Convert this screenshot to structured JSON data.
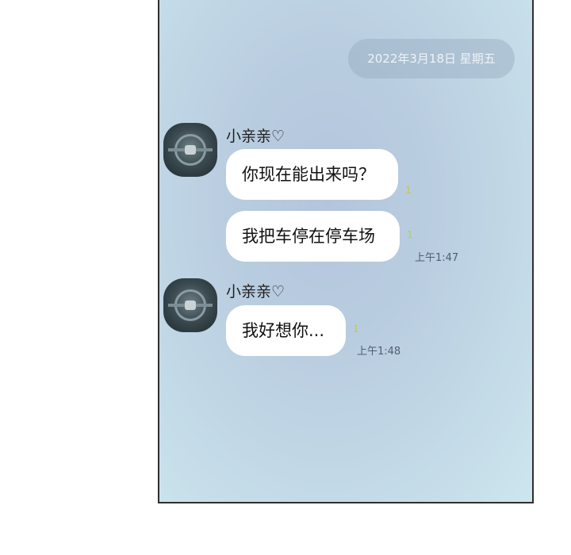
{
  "chat": {
    "date": "2022年3月18日 星期五",
    "groups": [
      {
        "sender": "小亲亲♡",
        "messages": [
          {
            "text": "你现在能出来吗？",
            "read": "1",
            "time": ""
          },
          {
            "text": "我把车停在停车场",
            "read": "1",
            "time": "上午1:47"
          }
        ]
      },
      {
        "sender": "小亲亲♡",
        "messages": [
          {
            "text": "我好想你...",
            "read": "1",
            "time": "上午1:48"
          }
        ]
      }
    ]
  },
  "icons": {
    "avatar": "steering-wheel-photo-icon"
  }
}
